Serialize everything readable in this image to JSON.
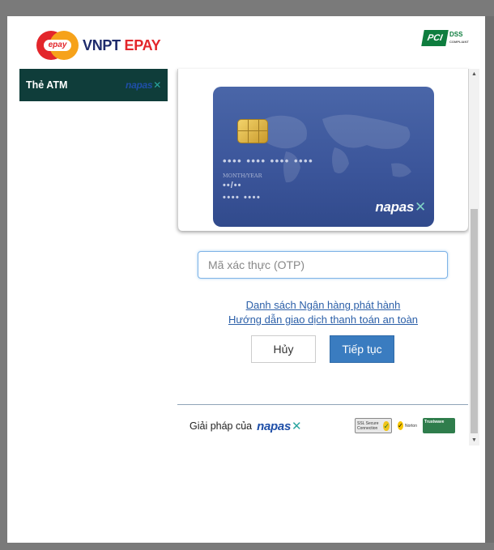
{
  "header": {
    "logo_badge": "epay",
    "logo_text_main": "VNPT",
    "logo_text_accent": "EPAY",
    "pci_mark": "PCI",
    "pci_text": "DSS",
    "pci_sub": "COMPLIANT"
  },
  "sidebar": {
    "items": [
      {
        "label": "Thẻ ATM",
        "brand": "napas"
      }
    ]
  },
  "card": {
    "number_mask": "•••• •••• •••• ••••",
    "exp_label": "MONTH/YEAR",
    "exp_mask": "••/••",
    "bottom_mask": "•••• ••••",
    "brand": "napas"
  },
  "form": {
    "otp_placeholder": "Mã xác thực (OTP)",
    "otp_value": ""
  },
  "links": {
    "issuers": "Danh sách Ngân hàng phát hành",
    "guide": "Hướng dẫn giao dịch thanh toán an toàn"
  },
  "buttons": {
    "cancel": "Hủy",
    "next": "Tiếp tục"
  },
  "footer": {
    "solution_text": "Giải pháp của",
    "brand": "napas",
    "seals": {
      "ssl": "SSL Secure Connection",
      "norton": "Norton",
      "trustwave": "Trustwave"
    }
  },
  "colors": {
    "brand_navy": "#1d2a6b",
    "brand_red": "#e3262b",
    "brand_orange": "#f6a21a",
    "sidebar_bg": "#0f3d3a",
    "primary_button": "#3a7cc0",
    "link": "#2b5fa8",
    "card_blue": "#3b559a"
  }
}
